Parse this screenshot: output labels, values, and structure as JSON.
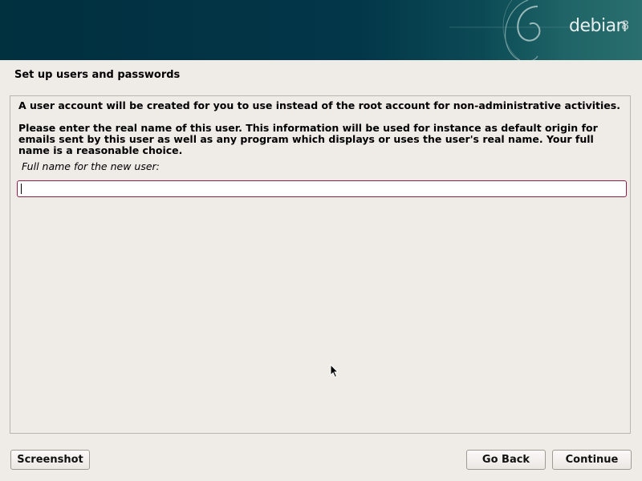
{
  "header": {
    "logo_text": "debian",
    "logo_version": "8"
  },
  "page": {
    "title": "Set up users and passwords"
  },
  "content": {
    "paragraph1": "A user account will be created for you to use instead of the root account for non-administrative activities.",
    "paragraph2": "Please enter the real name of this user. This information will be used for instance as default origin for emails sent by this user as well as any program which displays or uses the user's real name. Your full name is a reasonable choice.",
    "field_label": "Full name for the new user:",
    "field_value": ""
  },
  "buttons": {
    "screenshot": "Screenshot",
    "go_back": "Go Back",
    "continue": "Continue"
  },
  "colors": {
    "banner": "#023649",
    "input_border": "#8b1e48",
    "background": "#efebe7"
  }
}
